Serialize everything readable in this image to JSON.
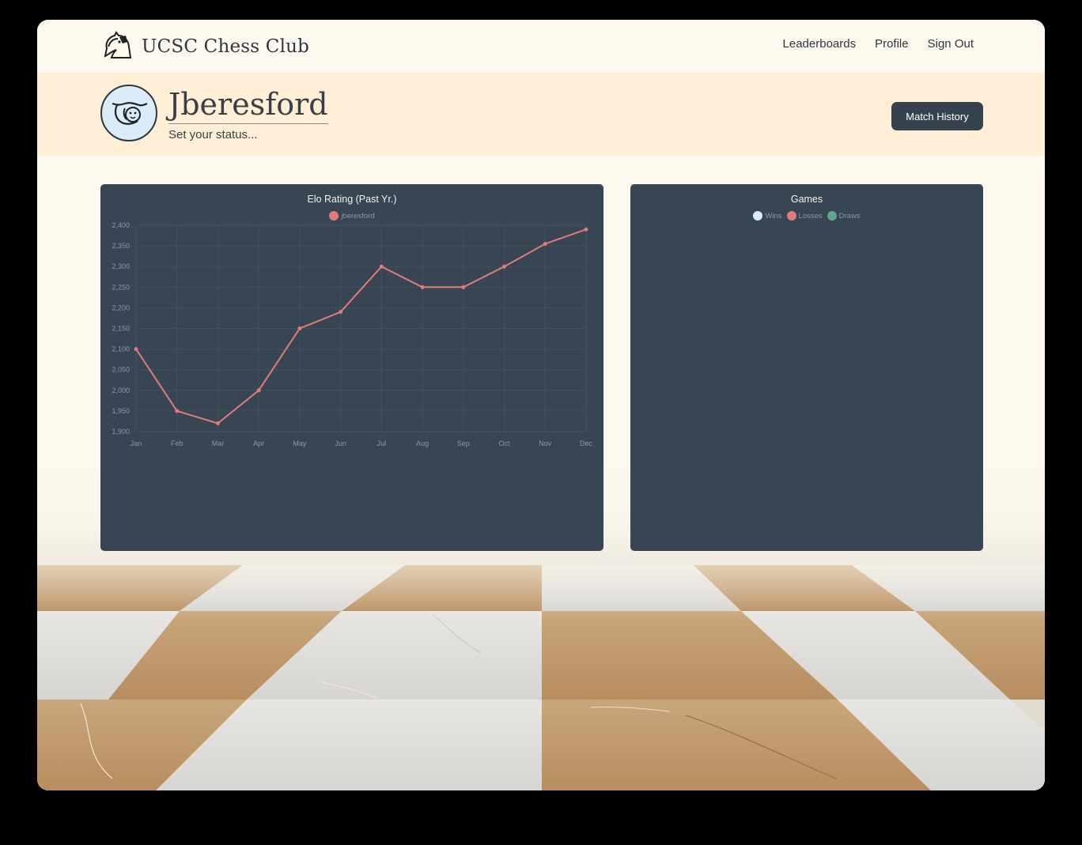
{
  "app": {
    "title": "UCSC Chess Club"
  },
  "nav": {
    "items": [
      "Leaderboards",
      "Profile",
      "Sign Out"
    ]
  },
  "profile": {
    "username": "Jberesford",
    "status_placeholder": "Set your status...",
    "match_history_label": "Match History"
  },
  "colors": {
    "navy": "#384653",
    "banner": "#ffefd6",
    "line": "#e07d7a",
    "wins": "#d9ecf8",
    "losses": "#e07d7a",
    "draws": "#5fa58f"
  },
  "chart_data": [
    {
      "type": "line",
      "title": "Elo Rating (Past Yr.)",
      "categories": [
        "Jan",
        "Feb",
        "Mar",
        "Apr",
        "May",
        "Jun",
        "Jul",
        "Aug",
        "Sep",
        "Oct",
        "Nov",
        "Dec"
      ],
      "series": [
        {
          "name": "jberesford",
          "values": [
            2100,
            1950,
            1920,
            2000,
            2150,
            2190,
            2300,
            2250,
            2250,
            2300,
            2355,
            2390
          ]
        }
      ],
      "ylim": [
        1900,
        2400
      ],
      "yticks": [
        "2,400",
        "2,350",
        "2,300",
        "2,250",
        "2,200",
        "2,150",
        "2,100",
        "2,050",
        "2,000",
        "1,950",
        "1,900"
      ],
      "grid": true,
      "legend": "top"
    },
    {
      "type": "pie",
      "title": "Games",
      "legend_items": [
        {
          "label": "Wins",
          "color": "#d9ecf8"
        },
        {
          "label": "Losses",
          "color": "#e07d7a"
        },
        {
          "label": "Draws",
          "color": "#5fa58f"
        }
      ],
      "values": []
    }
  ]
}
